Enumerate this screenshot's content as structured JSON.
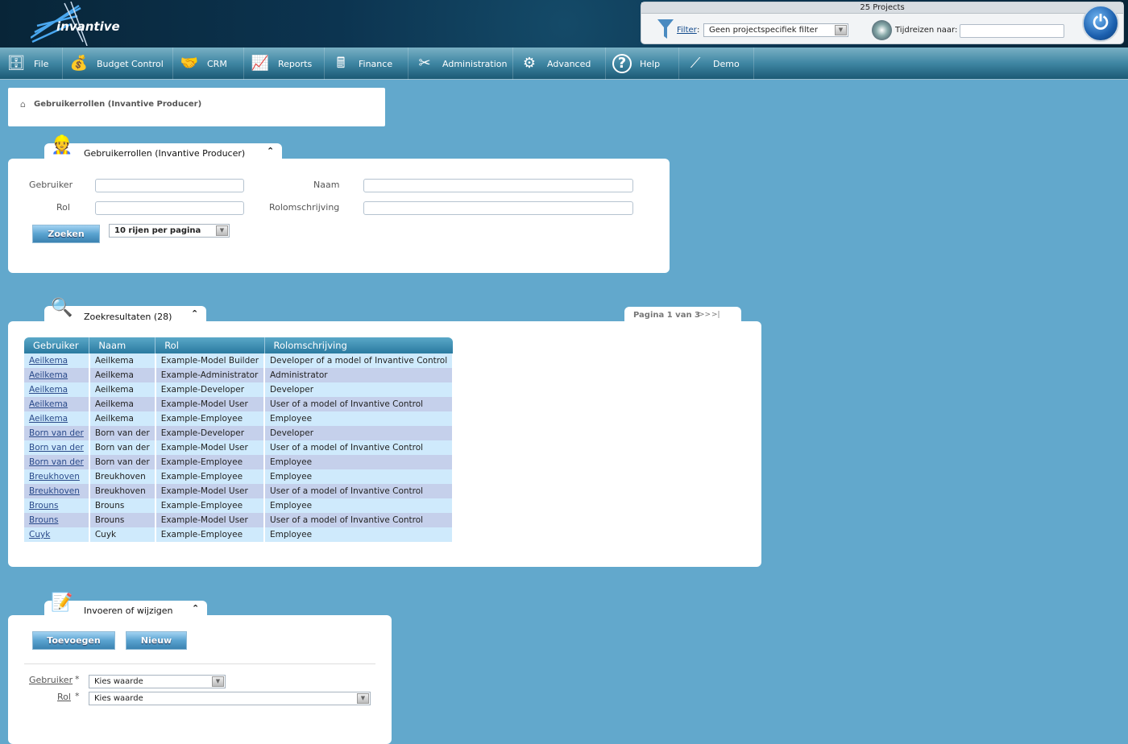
{
  "header": {
    "logo": "invantive",
    "projects": "25 Projects",
    "filter_label": "Filter",
    "filter_value": "Geen projectspecifiek filter",
    "timetravel_label": "Tijdreizen naar:",
    "timetravel_value": ""
  },
  "nav": [
    {
      "label": "File",
      "icon": "file-cabinet-icon"
    },
    {
      "label": "Budget Control",
      "icon": "money-bag-icon"
    },
    {
      "label": "CRM",
      "icon": "handshake-icon"
    },
    {
      "label": "Reports",
      "icon": "presentation-icon"
    },
    {
      "label": "Finance",
      "icon": "calculator-icon"
    },
    {
      "label": "Administration",
      "icon": "tools-icon"
    },
    {
      "label": "Advanced",
      "icon": "gears-icon"
    },
    {
      "label": "Help",
      "icon": "help-icon"
    },
    {
      "label": "Demo",
      "icon": "demo-logo-icon"
    }
  ],
  "breadcrumb": "Gebruikerrollen (Invantive Producer)",
  "search": {
    "title": "Gebruikerrollen (Invantive Producer)",
    "gebruiker_label": "Gebruiker",
    "naam_label": "Naam",
    "rol_label": "Rol",
    "rolomschrijving_label": "Rolomschrijving",
    "zoeken": "Zoeken",
    "rows_per_page": "10 rijen per pagina"
  },
  "results": {
    "title": "Zoekresultaten (28)",
    "pager": "Pagina 1 van 3",
    "next": ">>",
    "last": ">|",
    "columns": [
      "Gebruiker",
      "Naam",
      "Rol",
      "Rolomschrijving"
    ],
    "rows": [
      [
        "Aeilkema",
        "Aeilkema",
        "Example-Model Builder",
        "Developer of a model of Invantive Control"
      ],
      [
        "Aeilkema",
        "Aeilkema",
        "Example-Administrator",
        "Administrator"
      ],
      [
        "Aeilkema",
        "Aeilkema",
        "Example-Developer",
        "Developer"
      ],
      [
        "Aeilkema",
        "Aeilkema",
        "Example-Model User",
        "User of a model of Invantive Control"
      ],
      [
        "Aeilkema",
        "Aeilkema",
        "Example-Employee",
        "Employee"
      ],
      [
        "Born van der",
        "Born van der",
        "Example-Developer",
        "Developer"
      ],
      [
        "Born van der",
        "Born van der",
        "Example-Model User",
        "User of a model of Invantive Control"
      ],
      [
        "Born van der",
        "Born van der",
        "Example-Employee",
        "Employee"
      ],
      [
        "Breukhoven",
        "Breukhoven",
        "Example-Employee",
        "Employee"
      ],
      [
        "Breukhoven",
        "Breukhoven",
        "Example-Model User",
        "User of a model of Invantive Control"
      ],
      [
        "Brouns",
        "Brouns",
        "Example-Employee",
        "Employee"
      ],
      [
        "Brouns",
        "Brouns",
        "Example-Model User",
        "User of a model of Invantive Control"
      ],
      [
        "Cuyk",
        "Cuyk",
        "Example-Employee",
        "Employee"
      ]
    ]
  },
  "edit": {
    "title": "Invoeren of wijzigen",
    "toevoegen": "Toevoegen",
    "nieuw": "Nieuw",
    "gebruiker_label": "Gebruiker",
    "rol_label": "Rol",
    "required": "*",
    "gebruiker_value": "Kies waarde",
    "rol_value": "Kies waarde"
  }
}
